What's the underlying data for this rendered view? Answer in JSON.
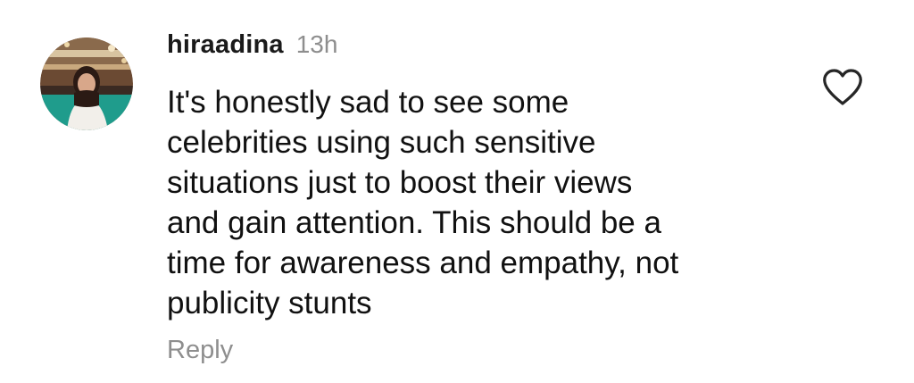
{
  "comment": {
    "username": "hiraadina",
    "timestamp": "13h",
    "text": "It's honestly sad to see some\ncelebrities using such sensitive\nsituations just to boost their views\nand gain attention. This should be a\ntime for awareness and empathy, not\npublicity stunts",
    "reply_label": "Reply",
    "like_icon": "heart-outline-icon",
    "avatar_icon": "user-avatar"
  },
  "colors": {
    "text": "#111111",
    "muted": "#8e8e8e",
    "background": "#ffffff"
  }
}
